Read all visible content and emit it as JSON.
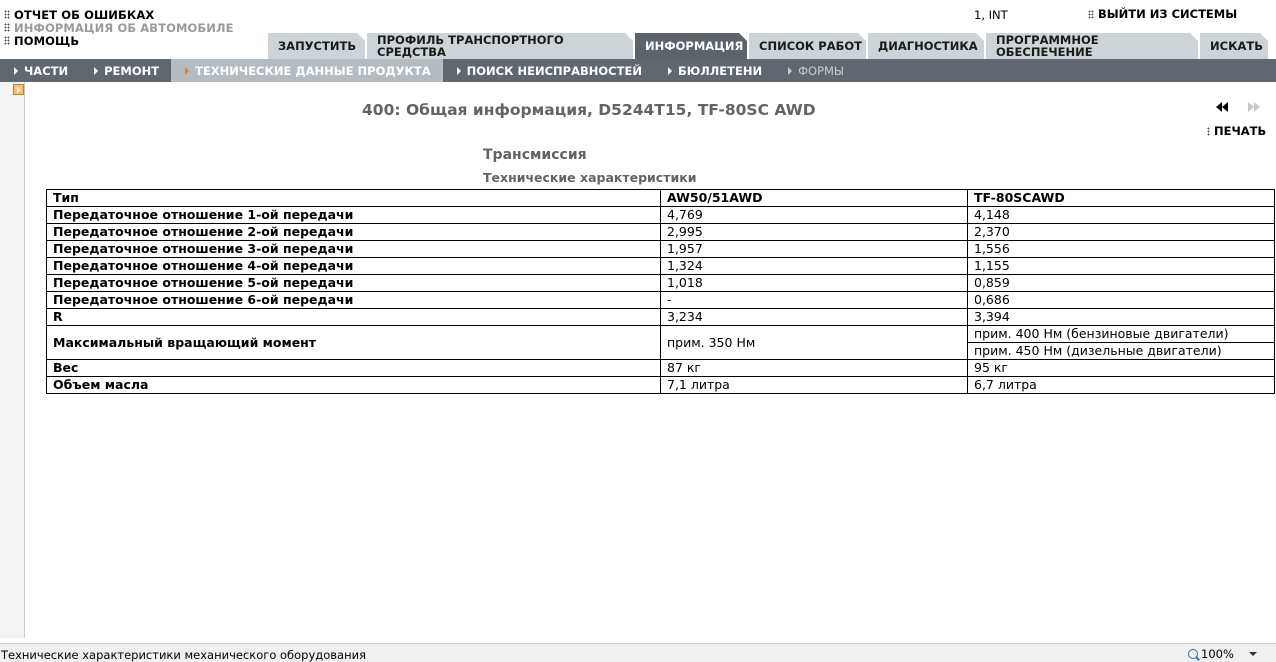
{
  "top_links": [
    {
      "label": "ОТЧЕТ ОБ ОШИБКАХ",
      "enabled": true
    },
    {
      "label": "ИНФОРМАЦИЯ ОБ АВТОМОБИЛЕ",
      "enabled": false
    },
    {
      "label": "ПОМОЩЬ",
      "enabled": true
    }
  ],
  "user": "1, INT",
  "logout_label": "ВЫЙТИ ИЗ СИСТЕМЫ",
  "main_tabs": [
    {
      "label": "ЗАПУСТИТЬ",
      "active": false
    },
    {
      "label": "ПРОФИЛЬ ТРАНСПОРТНОГО СРЕДСТВА",
      "active": false
    },
    {
      "label": "ИНФОРМАЦИЯ",
      "active": true
    },
    {
      "label": "СПИСОК РАБОТ",
      "active": false
    },
    {
      "label": "ДИАГНОСТИКА",
      "active": false
    },
    {
      "label": "ПРОГРАММНОЕ ОБЕСПЕЧЕНИЕ",
      "active": false
    },
    {
      "label": "ИСКАТЬ",
      "active": false
    }
  ],
  "sub_nav": [
    {
      "label": "ЧАСТИ",
      "state": "normal"
    },
    {
      "label": "РЕМОНТ",
      "state": "normal"
    },
    {
      "label": "ТЕХНИЧЕСКИЕ ДАННЫЕ ПРОДУКТА",
      "state": "active"
    },
    {
      "label": "ПОИСК НЕИСПРАВНОСТЕЙ",
      "state": "normal"
    },
    {
      "label": "БЮЛЛЕТЕНИ",
      "state": "normal"
    },
    {
      "label": "ФОРМЫ",
      "state": "disabled"
    }
  ],
  "page_title": "400: Общая информация, D5244T15, TF-80SC AWD",
  "print_label": "ПЕЧАТЬ",
  "section_title": "Трансмиссия",
  "subsection_title": "Технические характеристики",
  "spec_table": {
    "headers": [
      "Тип",
      "AW50/51AWD",
      "TF-80SCAWD"
    ],
    "rows": [
      [
        "Передаточное отношение 1-ой передачи",
        "4,769",
        "4,148"
      ],
      [
        "Передаточное отношение 2-ой передачи",
        "2,995",
        "2,370"
      ],
      [
        "Передаточное отношение 3-ой передачи",
        "1,957",
        "1,556"
      ],
      [
        "Передаточное отношение 4-ой передачи",
        "1,324",
        "1,155"
      ],
      [
        "Передаточное отношение 5-ой передачи",
        "1,018",
        "0,859"
      ],
      [
        "Передаточное отношение 6-ой передачи",
        "-",
        "0,686"
      ],
      [
        "R",
        "3,234",
        "3,394"
      ]
    ],
    "torque_row": {
      "label": "Максимальный вращающий момент",
      "aw": "прим. 350 Нм",
      "tf": [
        "прим. 400 Нм (бензиновые двигатели)",
        "прим. 450 Нм (дизельные двигатели)"
      ]
    },
    "tail_rows": [
      [
        "Вес",
        "87 кг",
        "95 кг"
      ],
      [
        "Объем масла",
        "7,1 литра",
        "6,7 литра"
      ]
    ]
  },
  "status_text": "Технические характеристики механического оборудования",
  "zoom": "100%"
}
